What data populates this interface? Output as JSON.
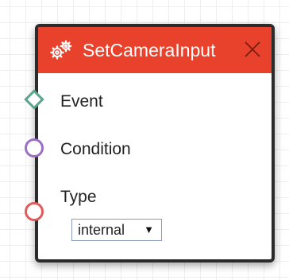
{
  "node": {
    "title": "SetCameraInput",
    "header_color": "#e8412c",
    "header_icon": "gears-icon",
    "close_icon": "close-icon"
  },
  "ports": {
    "event": {
      "label": "Event",
      "shape": "diamond",
      "color": "#5aa58a"
    },
    "condition": {
      "label": "Condition",
      "shape": "circle",
      "color": "#9a6fc4"
    },
    "type": {
      "label": "Type",
      "shape": "circle",
      "color": "#e35a5a"
    }
  },
  "type_select": {
    "selected": "internal",
    "arrow": "▼"
  }
}
